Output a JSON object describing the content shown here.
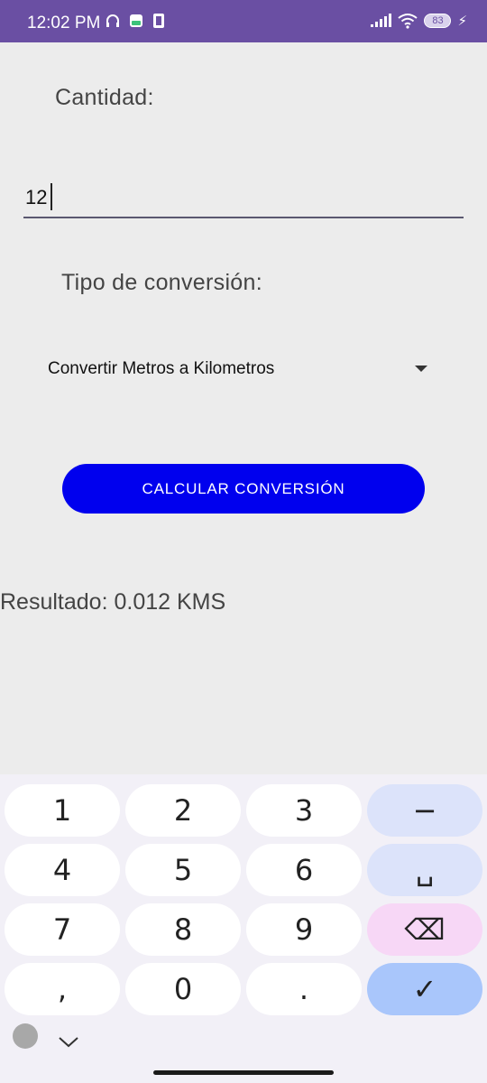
{
  "status_bar": {
    "time": "12:02 PM",
    "battery": "83",
    "icons": [
      "headphones-icon",
      "game-icon",
      "sim-icon",
      "signal-icon",
      "wifi-icon",
      "battery-icon",
      "charging-icon"
    ]
  },
  "form": {
    "cantidad_label": "Cantidad:",
    "cantidad_value": "12",
    "tipo_label": "Tipo de conversión:",
    "tipo_selected": "Convertir Metros a Kilometros",
    "calcular_button": "CALCULAR CONVERSIÓN",
    "resultado": "Resultado: 0.012 KMS"
  },
  "keyboard": {
    "rows": [
      [
        "1",
        "2",
        "3",
        "−"
      ],
      [
        "4",
        "5",
        "6",
        "␣"
      ],
      [
        "7",
        "8",
        "9",
        "⌫"
      ],
      [
        ",",
        "0",
        ".",
        "✓"
      ]
    ],
    "collapse_icon": "chevron-down-icon"
  },
  "colors": {
    "status_bar": "#6a4fa3",
    "button": "#0000ee",
    "background": "#ececec",
    "keyboard": "#f2f0f7"
  }
}
